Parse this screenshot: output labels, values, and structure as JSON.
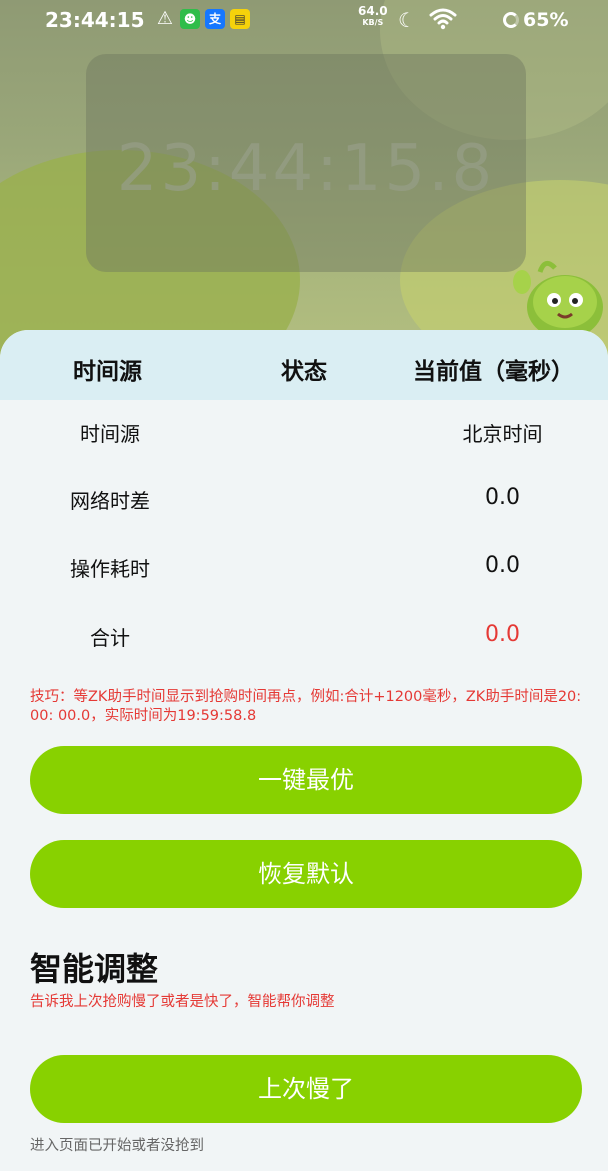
{
  "status_bar": {
    "time": "23:44:15",
    "net_speed_value": "64.0",
    "net_speed_unit": "KB/S",
    "battery": "65%"
  },
  "clock": {
    "display": "23:44:15.8"
  },
  "table": {
    "headers": [
      "时间源",
      "状态",
      "当前值（毫秒）"
    ],
    "rows": [
      {
        "label": "时间源",
        "value": "北京时间"
      },
      {
        "label": "网络时差",
        "value": "0.0"
      },
      {
        "label": "操作耗时",
        "value": "0.0"
      },
      {
        "label": "合计",
        "value": "0.0"
      }
    ]
  },
  "tip": "技巧：等ZK助手时间显示到抢购时间再点，例如:合计+1200毫秒，ZK助手时间是20: 00: 00.0，实际时间为19:59:58.8",
  "buttons": {
    "optimal": "一键最优",
    "reset": "恢复默认",
    "slow": "上次慢了"
  },
  "smart": {
    "title": "智能调整",
    "subtitle": "告诉我上次抢购慢了或者是快了，智能帮你调整"
  },
  "footer_note": "进入页面已开始或者没抢到",
  "colors": {
    "accent_green": "#88d100",
    "header_bg": "#daeef3",
    "warning_red": "#e53935"
  }
}
